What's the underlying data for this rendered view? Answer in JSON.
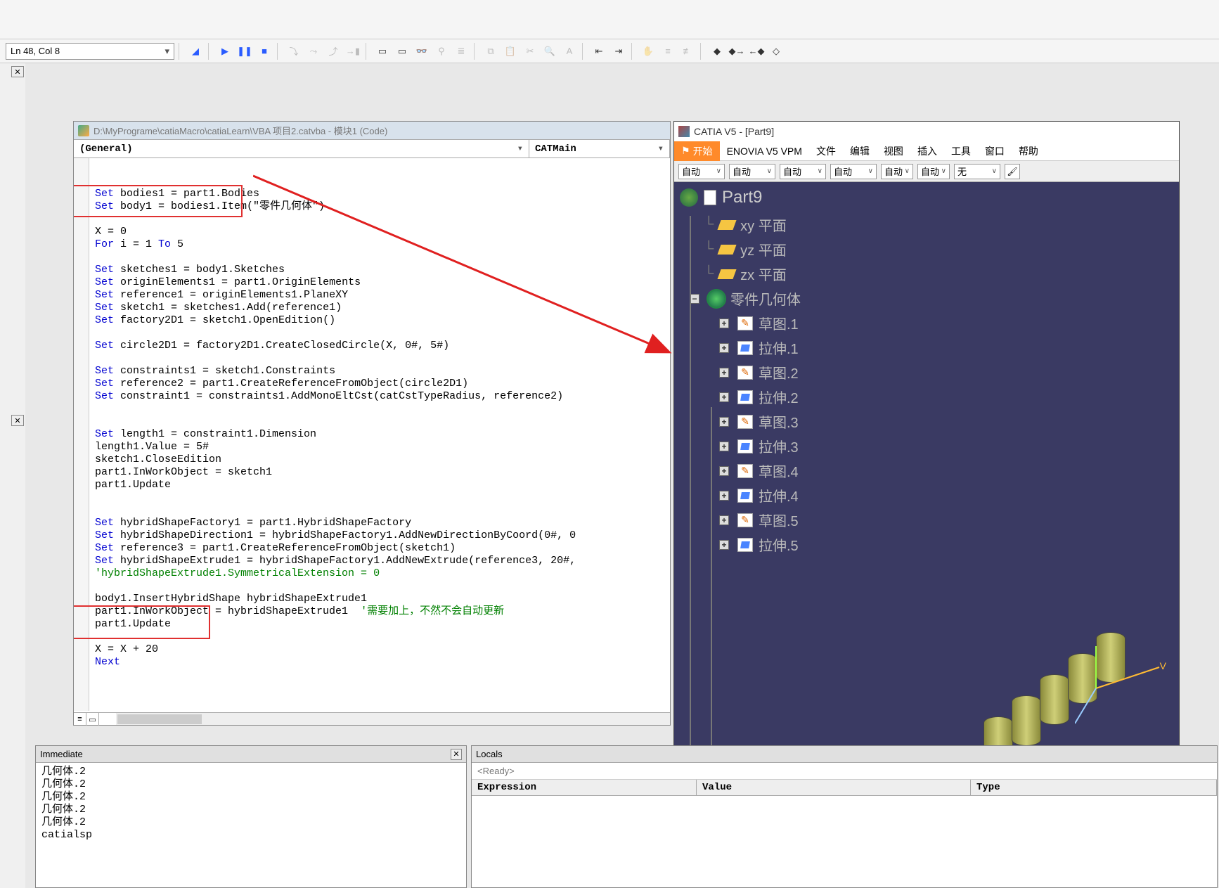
{
  "status_line": "Ln 48, Col 8",
  "vba": {
    "title": "D:\\MyPrograme\\catiaMacro\\catiaLearn\\VBA 项目2.catvba - 模块1 (Code)",
    "dd_left": "(General)",
    "dd_right": "CATMain",
    "code": {
      "l1a": "Set",
      "l1b": " bodies1 = part1.Bodies",
      "l2a": "Set",
      "l2b": " body1 = bodies1.Item(\"零件几何体\")",
      "l3a": "X = 0",
      "l4a": "For",
      "l4b": " i = 1 ",
      "l4c": "To",
      "l4d": " 5",
      "l5a": "Set",
      "l5b": " sketches1 = body1.Sketches",
      "l6a": "Set",
      "l6b": " originElements1 = part1.OriginElements",
      "l7a": "Set",
      "l7b": " reference1 = originElements1.PlaneXY",
      "l8a": "Set",
      "l8b": " sketch1 = sketches1.Add(reference1)",
      "l9a": "Set",
      "l9b": " factory2D1 = sketch1.OpenEdition()",
      "l10a": "Set",
      "l10b": " circle2D1 = factory2D1.CreateClosedCircle(X, 0#, 5#)",
      "l11a": "Set",
      "l11b": " constraints1 = sketch1.Constraints",
      "l12a": "Set",
      "l12b": " reference2 = part1.CreateReferenceFromObject(circle2D1)",
      "l13a": "Set",
      "l13b": " constraint1 = constraints1.AddMonoEltCst(catCstTypeRadius, reference2)",
      "l14a": "Set",
      "l14b": " length1 = constraint1.Dimension",
      "l15": "length1.Value = 5#",
      "l16": "sketch1.CloseEdition",
      "l17": "part1.InWorkObject = sketch1",
      "l18": "part1.Update",
      "l19a": "Set",
      "l19b": " hybridShapeFactory1 = part1.HybridShapeFactory",
      "l20a": "Set",
      "l20b": " hybridShapeDirection1 = hybridShapeFactory1.AddNewDirectionByCoord(0#, 0",
      "l21a": "Set",
      "l21b": " reference3 = part1.CreateReferenceFromObject(sketch1)",
      "l22a": "Set",
      "l22b": " hybridShapeExtrude1 = hybridShapeFactory1.AddNewExtrude(reference3, 20#,",
      "l23": "'hybridShapeExtrude1.SymmetricalExtension = 0",
      "l24": "body1.InsertHybridShape hybridShapeExtrude1",
      "l25a": "part1.InWorkObject = hybridShapeExtrude1  ",
      "l25b": "'需要加上，不然不会自动更新",
      "l26": "part1.Update",
      "l27": "X = X + 20",
      "l28": "Next"
    }
  },
  "immediate": {
    "title": "Immediate",
    "lines": [
      "几何体.2",
      "几何体.2",
      "几何体.2",
      "几何体.2",
      "几何体.2",
      "catialsp"
    ]
  },
  "locals": {
    "title": "Locals",
    "ready": "<Ready>",
    "cols": {
      "exp": "Expression",
      "val": "Value",
      "typ": "Type"
    }
  },
  "catia": {
    "title": "CATIA V5 - [Part9]",
    "menu_start": "开始",
    "menu_items": [
      "ENOVIA V5 VPM",
      "文件",
      "编辑",
      "视图",
      "插入",
      "工具",
      "窗口",
      "帮助"
    ],
    "combos": [
      "自动",
      "自动",
      "自动",
      "自动",
      "自动",
      "自动",
      "无"
    ],
    "root": "Part9",
    "planes": [
      "xy 平面",
      "yz 平面",
      "zx 平面"
    ],
    "body": "零件几何体",
    "features": [
      "草图.1",
      "拉伸.1",
      "草图.2",
      "拉伸.2",
      "草图.3",
      "拉伸.3",
      "草图.4",
      "拉伸.4",
      "草图.5",
      "拉伸.5"
    ],
    "axis_v": "V"
  }
}
